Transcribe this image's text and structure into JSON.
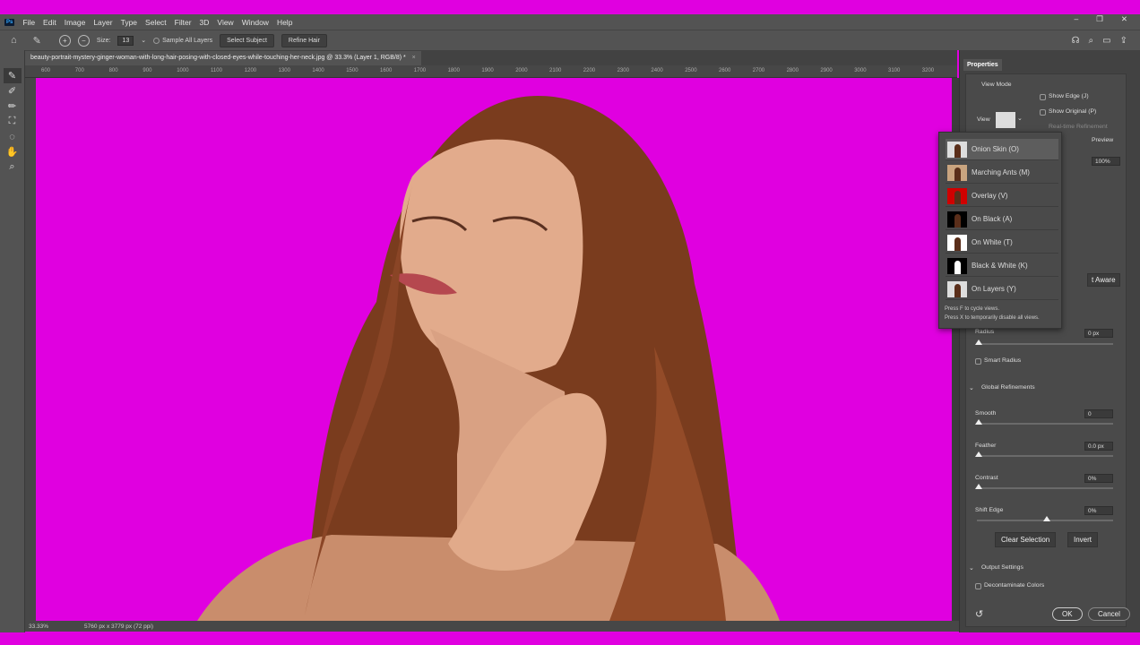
{
  "menubar": {
    "logo": "Ps",
    "items": [
      "File",
      "Edit",
      "Image",
      "Layer",
      "Type",
      "Select",
      "Filter",
      "3D",
      "View",
      "Window",
      "Help"
    ],
    "window_controls": [
      "–",
      "❐",
      "✕"
    ]
  },
  "options": {
    "size_label": "Size:",
    "size_value": "13",
    "sample_all_layers": "Sample All Layers",
    "select_subject": "Select Subject",
    "refine_hair": "Refine Hair"
  },
  "document": {
    "tab_title": "beauty-portrait-mystery-ginger-woman-with-long-hair-posing-with-closed-eyes-while-touching-her-neck.jpg @ 33.3% (Layer 1, RGB/8) *",
    "close": "×"
  },
  "ruler": [
    "600",
    "700",
    "800",
    "900",
    "1000",
    "1100",
    "1200",
    "1300",
    "1400",
    "1500",
    "1600",
    "1700",
    "1800",
    "1900",
    "2000",
    "2100",
    "2200",
    "2300",
    "2400",
    "2500",
    "2600",
    "2700",
    "2800",
    "2900",
    "3000",
    "3100",
    "3200"
  ],
  "status": {
    "zoom": "33.33%",
    "dimensions": "5760 px x 3779 px (72 ppi)"
  },
  "colors": {
    "canvas_bg": "#e000e0",
    "ui_dark": "#535353",
    "panel": "#4a4a4a"
  },
  "properties": {
    "tab": "Properties",
    "view_mode": "View Mode",
    "view_label": "View",
    "show_edge": "Show Edge (J)",
    "show_original": "Show Original (P)",
    "real_time": "Real-time Refinement",
    "preview": "Preview",
    "opacity": "100%",
    "content_aware": "t Aware",
    "radius_label": "Radius",
    "radius_value": "0 px",
    "smart_radius": "Smart Radius",
    "global_refinements": "Global Refinements",
    "smooth_label": "Smooth",
    "smooth_value": "0",
    "feather_label": "Feather",
    "feather_value": "0.0 px",
    "contrast_label": "Contrast",
    "contrast_value": "0%",
    "shift_label": "Shift Edge",
    "shift_value": "0%",
    "clear_selection": "Clear Selection",
    "invert": "Invert",
    "output_settings": "Output Settings",
    "decontaminate": "Decontaminate Colors",
    "ok": "OK",
    "cancel": "Cancel"
  },
  "sliders": {
    "radius": 0,
    "smooth": 0,
    "feather": 0,
    "contrast": 0,
    "shift_edge": 0.5,
    "opacity": 1.0
  },
  "view_menu": {
    "items": [
      {
        "label": "Onion Skin (O)",
        "bg": "#ddd"
      },
      {
        "label": "Marching Ants (M)",
        "bg": "#c9a47f"
      },
      {
        "label": "Overlay (V)",
        "bg": "#d00000"
      },
      {
        "label": "On Black (A)",
        "bg": "#000"
      },
      {
        "label": "On White (T)",
        "bg": "#fff"
      },
      {
        "label": "Black & White (K)",
        "bg": "#000"
      },
      {
        "label": "On Layers (Y)",
        "bg": "#ddd"
      }
    ],
    "hint1": "Press F to cycle views.",
    "hint2": "Press X to temporarily disable all views."
  }
}
